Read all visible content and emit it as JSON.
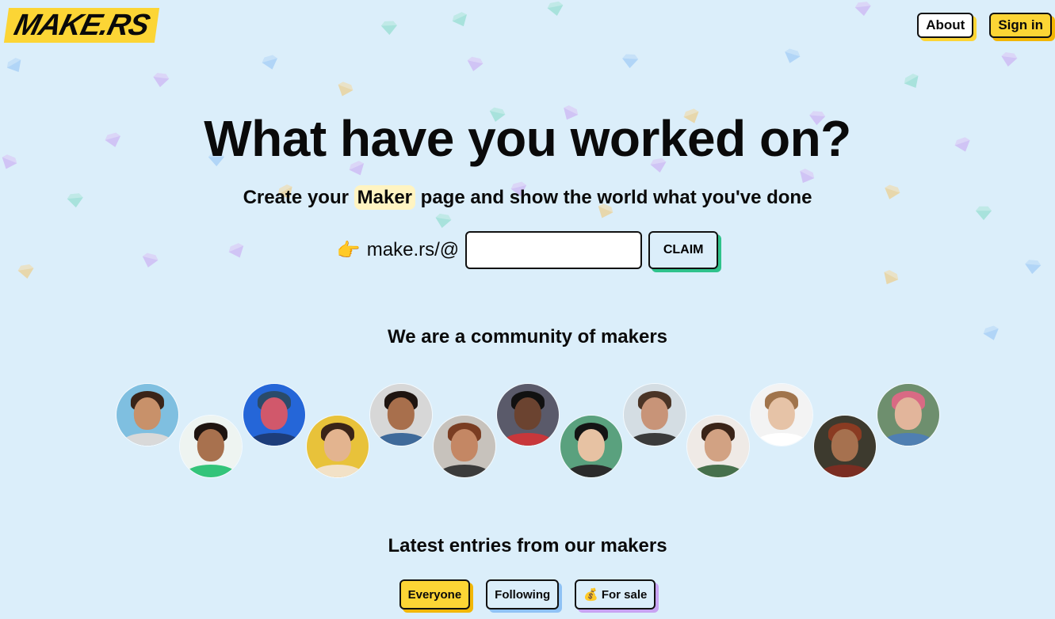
{
  "header": {
    "logo_text": "MAKE.RS",
    "nav": {
      "about": "About",
      "sign_in": "Sign in"
    }
  },
  "hero": {
    "title": "What have you worked on?",
    "subtitle_before": "Create your",
    "subtitle_highlight": "Maker",
    "subtitle_after": "page and show the world what you've done",
    "claim_prefix_emoji": "👉",
    "claim_prefix": "make.rs/@",
    "claim_input_value": "",
    "claim_button": "CLAIM"
  },
  "community": {
    "title": "We are a community of makers"
  },
  "latest": {
    "title": "Latest entries from our makers",
    "tabs": [
      {
        "label": "Everyone",
        "emoji": "",
        "active": true
      },
      {
        "label": "Following",
        "emoji": "",
        "active": false
      },
      {
        "label": "For sale",
        "emoji": "💰",
        "active": false
      }
    ]
  },
  "colors": {
    "background": "#dbeefa",
    "accent_yellow": "#fcd535",
    "claim_shadow_green": "#2fc28b"
  }
}
